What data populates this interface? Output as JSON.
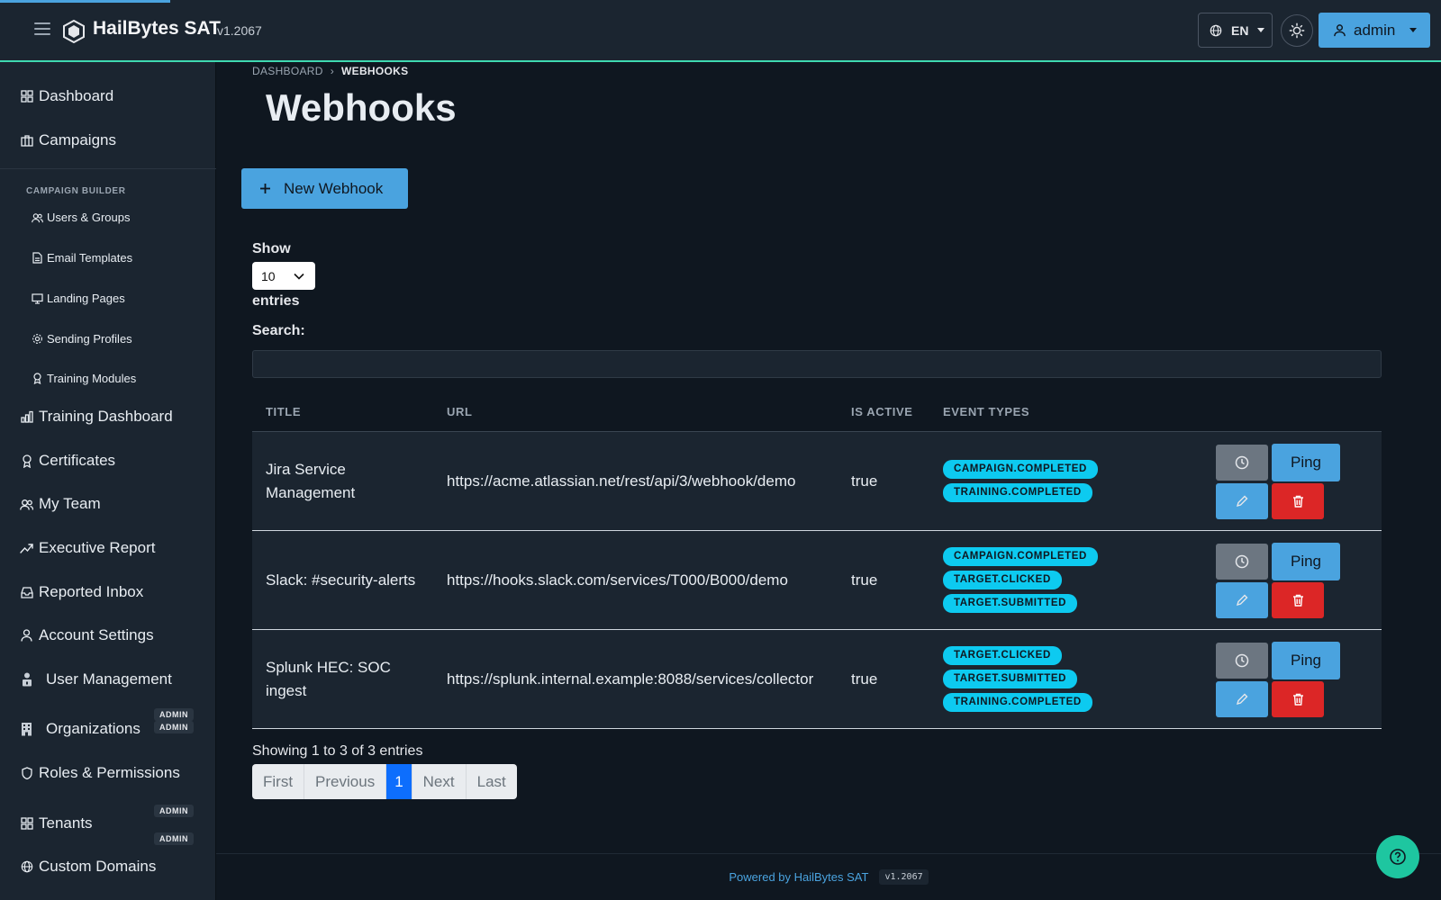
{
  "header": {
    "brand": "HailBytes SAT",
    "version": "v1.2067",
    "language": "EN",
    "user": "admin",
    "accent_color": "#3fd9b0",
    "primary_color": "#4aa3df"
  },
  "sidebar": {
    "items_top": [
      {
        "label": "Dashboard",
        "icon": "grid-icon"
      },
      {
        "label": "Campaigns",
        "icon": "briefcase-icon"
      }
    ],
    "section_label": "CAMPAIGN BUILDER",
    "builder_items": [
      {
        "label": "Users & Groups",
        "icon": "users-icon"
      },
      {
        "label": "Email Templates",
        "icon": "document-icon"
      },
      {
        "label": "Landing Pages",
        "icon": "monitor-icon"
      },
      {
        "label": "Sending Profiles",
        "icon": "gear-icon"
      },
      {
        "label": "Training Modules",
        "icon": "award-icon"
      }
    ],
    "items_bottom": [
      {
        "label": "Training Dashboard",
        "icon": "bar-chart-icon"
      },
      {
        "label": "Certificates",
        "icon": "award-icon"
      },
      {
        "label": "My Team",
        "icon": "users-icon"
      },
      {
        "label": "Executive Report",
        "icon": "trending-up-icon"
      },
      {
        "label": "Reported Inbox",
        "icon": "inbox-icon"
      },
      {
        "label": "Account Settings",
        "icon": "user-icon"
      },
      {
        "label": "User Management",
        "icon": "user-lock-icon",
        "badge": "ADMIN"
      },
      {
        "label": "Organizations",
        "icon": "building-icon",
        "badge": "ADMIN"
      },
      {
        "label": "Roles & Permissions",
        "icon": "shield-icon",
        "badge": "ADMIN"
      },
      {
        "label": "Tenants",
        "icon": "grid-icon",
        "badge": "ADMIN"
      },
      {
        "label": "Custom Domains",
        "icon": "globe-icon"
      }
    ]
  },
  "breadcrumb": {
    "root": "DASHBOARD",
    "current": "WEBHOOKS"
  },
  "page": {
    "title": "Webhooks",
    "new_button": "New Webhook",
    "show_label": "Show",
    "page_length": "10",
    "entries_label": "entries",
    "search_label": "Search:",
    "search_value": ""
  },
  "table": {
    "columns": [
      "TITLE",
      "URL",
      "IS ACTIVE",
      "EVENT TYPES"
    ],
    "rows": [
      {
        "title": "Jira Service Management",
        "url": "https://acme.atlassian.net/rest/api/3/webhook/demo",
        "active": "true",
        "events": [
          "CAMPAIGN.COMPLETED",
          "TRAINING.COMPLETED"
        ]
      },
      {
        "title": "Slack: #security-alerts",
        "url": "https://hooks.slack.com/services/T000/B000/demo",
        "active": "true",
        "events": [
          "CAMPAIGN.COMPLETED",
          "TARGET.CLICKED",
          "TARGET.SUBMITTED"
        ]
      },
      {
        "title": "Splunk HEC: SOC ingest",
        "url": "https://splunk.internal.example:8088/services/collector",
        "active": "true",
        "events": [
          "TARGET.CLICKED",
          "TARGET.SUBMITTED",
          "TRAINING.COMPLETED"
        ]
      }
    ],
    "ping_label": "Ping"
  },
  "pagination": {
    "info": "Showing 1 to 3 of 3 entries",
    "first": "First",
    "previous": "Previous",
    "current": "1",
    "next": "Next",
    "last": "Last"
  },
  "footer": {
    "powered_by": "Powered by HailBytes SAT",
    "version": "v1.2067"
  }
}
